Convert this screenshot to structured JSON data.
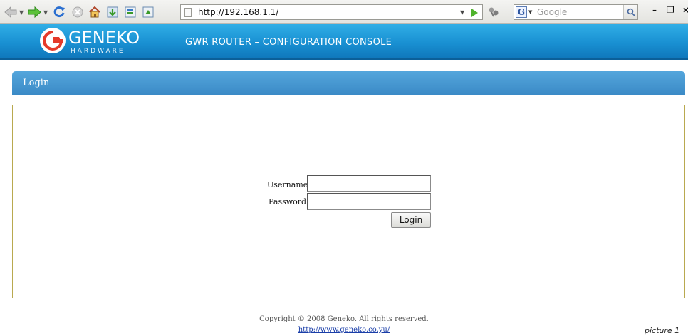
{
  "browser": {
    "url": "http://192.168.1.1/",
    "search_placeholder": "Google",
    "search_engine_letter": "G",
    "icons": [
      "back-icon",
      "forward-icon",
      "reload-icon",
      "stop-icon",
      "home-icon",
      "download-icon",
      "bookmark-icon",
      "screenshot-icon",
      "page-icon",
      "go-icon",
      "addon-icon",
      "search-icon"
    ],
    "window_controls": {
      "minimize": "–",
      "maximize": "❐",
      "close": "×"
    }
  },
  "banner": {
    "logo_word": "GENEKO",
    "logo_sub": "HARDWARE",
    "title": "GWR ROUTER – CONFIGURATION CONSOLE",
    "colors": {
      "banner_top": "#30aee6",
      "banner_bottom": "#0f77bb",
      "logo_mark": "#e53a2a"
    }
  },
  "login": {
    "header": "Login",
    "username_label": "Username",
    "password_label": "Password",
    "username_value": "",
    "password_value": "",
    "button_label": "Login",
    "colors": {
      "header": "#4a9bd4",
      "panel_border": "#b9a94f"
    }
  },
  "footer": {
    "copyright": "Copyright © 2008 Geneko. All rights reserved.",
    "link": "http://www.geneko.co.yu/",
    "caption": "picture 1"
  }
}
